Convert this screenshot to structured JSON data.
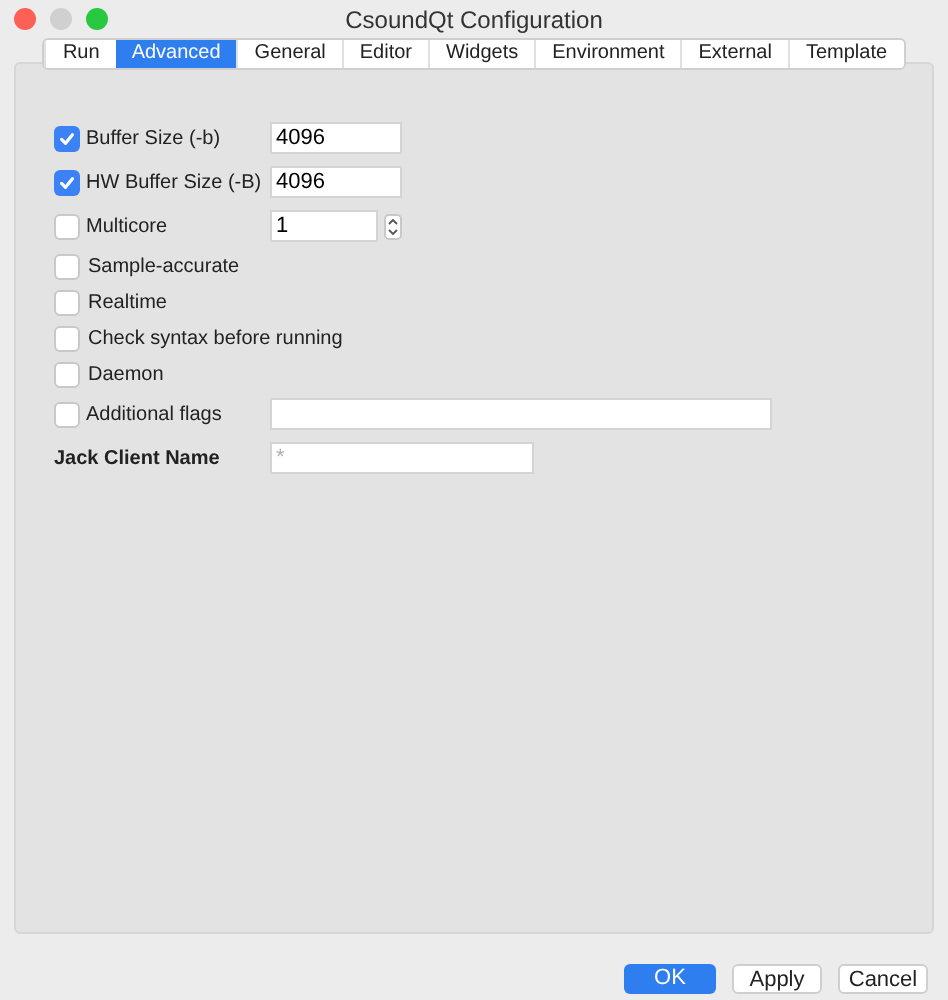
{
  "window": {
    "title": "CsoundQt Configuration"
  },
  "tabs": [
    {
      "label": "Run",
      "selected": false
    },
    {
      "label": "Advanced",
      "selected": true
    },
    {
      "label": "General",
      "selected": false
    },
    {
      "label": "Editor",
      "selected": false
    },
    {
      "label": "Widgets",
      "selected": false
    },
    {
      "label": "Environment",
      "selected": false
    },
    {
      "label": "External",
      "selected": false
    },
    {
      "label": "Template",
      "selected": false
    }
  ],
  "options": [
    {
      "kind": "checkbox_field",
      "label": "Buffer Size (-b)",
      "checked": true,
      "value": "4096"
    },
    {
      "kind": "checkbox_field",
      "label": "HW Buffer Size (-B)",
      "checked": true,
      "value": "4096"
    },
    {
      "kind": "checkbox_spin",
      "label": "Multicore",
      "checked": false,
      "value": "1"
    },
    {
      "kind": "checkbox",
      "label": "Sample-accurate",
      "checked": false
    },
    {
      "kind": "checkbox",
      "label": "Realtime",
      "checked": false
    },
    {
      "kind": "checkbox",
      "label": "Check syntax before running",
      "checked": false
    },
    {
      "kind": "checkbox",
      "label": "Daemon",
      "checked": false
    },
    {
      "kind": "checkbox_wide",
      "label": "Additional flags",
      "checked": false
    },
    {
      "kind": "label_field",
      "label": "Jack Client Name",
      "placeholder": "*"
    }
  ],
  "buttons": [
    {
      "label": "OK",
      "default": true
    },
    {
      "label": "Apply",
      "default": false
    },
    {
      "label": "Cancel",
      "default": false
    }
  ]
}
